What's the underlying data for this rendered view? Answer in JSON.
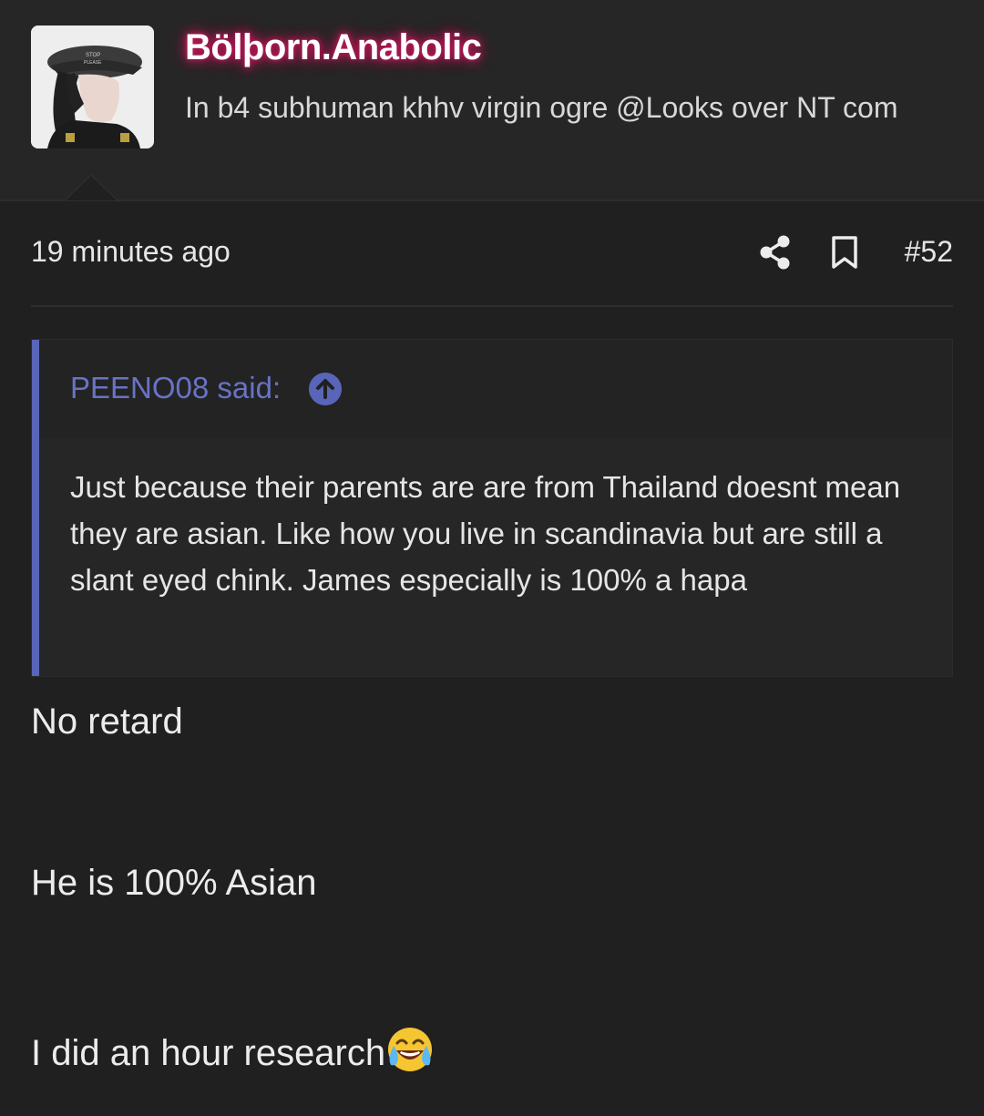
{
  "post": {
    "username": "Bölþorn.Anabolic",
    "user_title": "In b4 subhuman khhv virgin ogre @Looks over NT com",
    "timestamp": "19 minutes ago",
    "post_number": "#52",
    "icons": {
      "avatar": "avatar-photo",
      "share": "share-icon",
      "bookmark": "bookmark-icon",
      "jump": "arrow-up-circle-icon",
      "emoji": "face-with-tears-of-joy-emoji"
    },
    "quote": {
      "author": "PEENO08 said:",
      "text": "Just because their parents are are from Thailand doesnt mean they are asian. Like how you live in scandinavia but are still a slant eyed chink. James especially is 100% a hapa"
    },
    "reply_lines": [
      "No retard",
      "He is 100% Asian",
      "I did an hour research"
    ]
  },
  "colors": {
    "background": "#202020",
    "header_background": "#262626",
    "accent": "#5865b8",
    "quote_author": "#6873c6",
    "username_glow": "#c2185b"
  }
}
